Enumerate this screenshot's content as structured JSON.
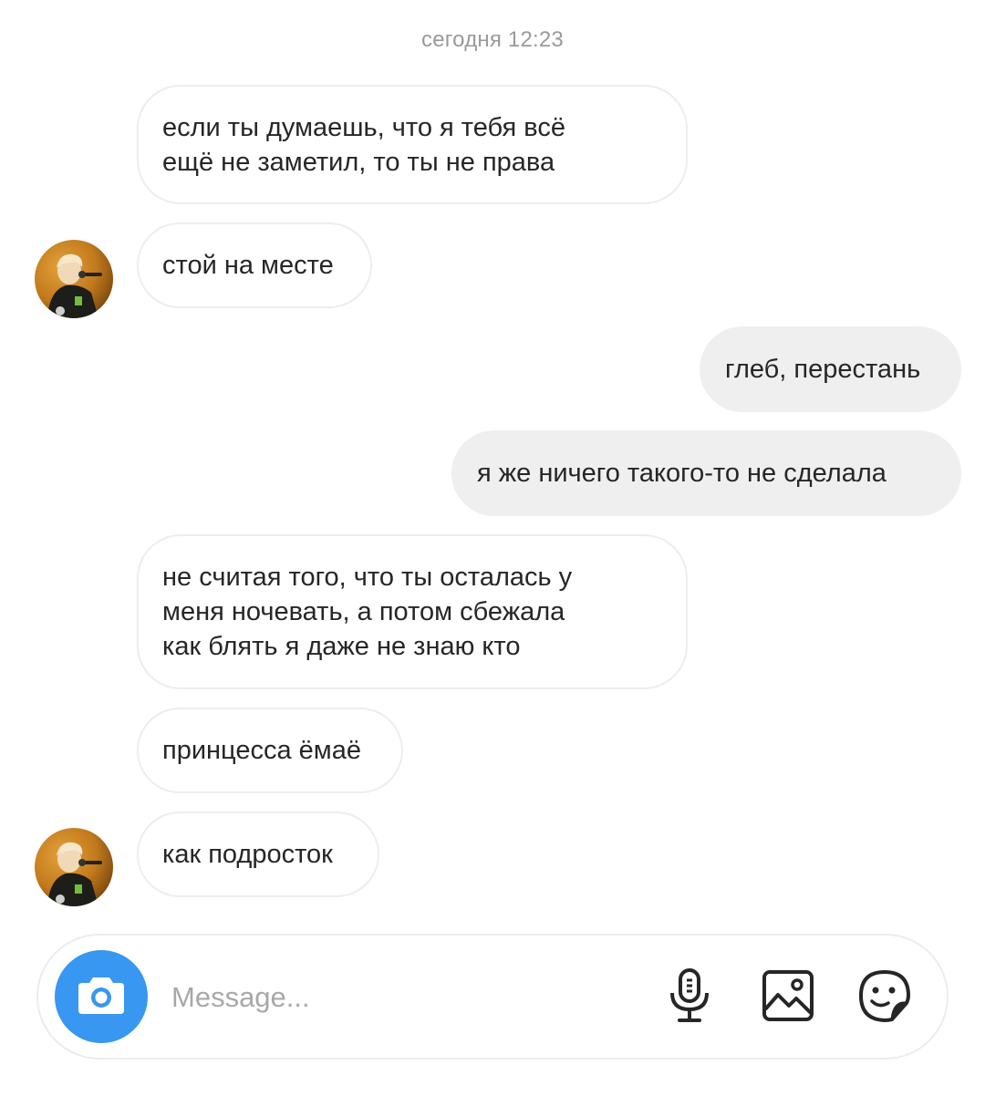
{
  "thread": {
    "timestamp": "сегодня 12:23",
    "messages": [
      {
        "from": "them",
        "lines": [
          "если ты думаешь,  что я тебя всё",
          "ещё не заметил, то ты не права"
        ]
      },
      {
        "from": "them",
        "lines": [
          "стой на месте"
        ],
        "avatar": true
      },
      {
        "from": "me",
        "lines": [
          "глеб, перестань"
        ]
      },
      {
        "from": "me",
        "lines": [
          "я же ничего такого-то не сделала"
        ]
      },
      {
        "from": "them",
        "lines": [
          "не считая того, что ты осталась у",
          "меня ночевать,  а потом сбежала",
          "как блять я даже не знаю кто"
        ]
      },
      {
        "from": "them",
        "lines": [
          "принцесса ёмаё"
        ]
      },
      {
        "from": "them",
        "lines": [
          "как подросток"
        ],
        "avatar": true
      }
    ]
  },
  "composer": {
    "placeholder": "Message...",
    "camera_icon": "camera-icon",
    "mic_icon": "microphone-icon",
    "gallery_icon": "gallery-icon",
    "sticker_icon": "sticker-icon",
    "accent_color": "#3897f0"
  }
}
